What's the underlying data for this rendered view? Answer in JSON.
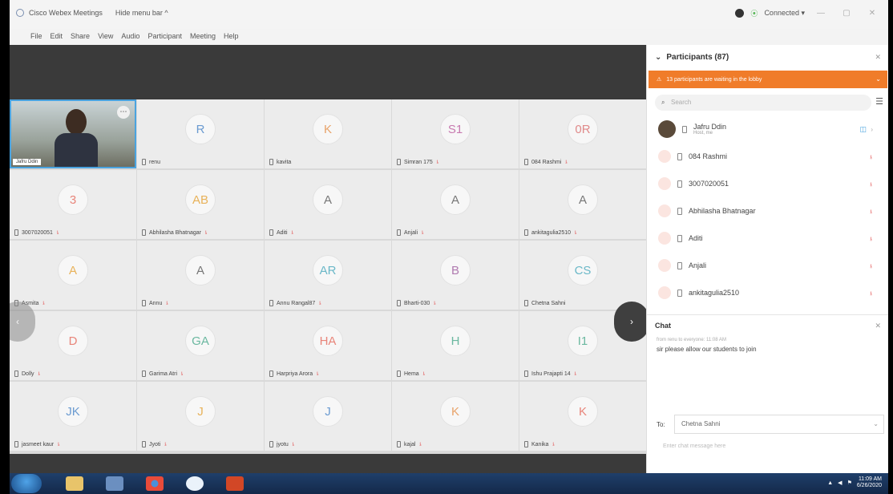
{
  "titlebar": {
    "app_name": "Cisco Webex Meetings",
    "hide_menu": "Hide menu bar ^",
    "status": "Connected ▾"
  },
  "menu": [
    "File",
    "Edit",
    "Share",
    "View",
    "Audio",
    "Participant",
    "Meeting",
    "Help"
  ],
  "host_tile": {
    "name": "Jafru Ddin"
  },
  "tiles": [
    {
      "initials": "R",
      "name": "renu",
      "color": "#6b9bd1",
      "muted": false
    },
    {
      "initials": "K",
      "name": "kavita",
      "color": "#e8a36a",
      "muted": false
    },
    {
      "initials": "S1",
      "name": "Simran 175",
      "color": "#c87ab0",
      "muted": true
    },
    {
      "initials": "0R",
      "name": "084 Rashmi",
      "color": "#e08a8a",
      "muted": true
    },
    {
      "initials": "3",
      "name": "3007020051",
      "color": "#e8857a",
      "muted": true
    },
    {
      "initials": "AB",
      "name": "Abhilasha Bhatnagar",
      "color": "#e8b25a",
      "muted": true
    },
    {
      "initials": "A",
      "name": "Aditi",
      "color": "#777777",
      "muted": true
    },
    {
      "initials": "A",
      "name": "Anjali",
      "color": "#777777",
      "muted": true
    },
    {
      "initials": "A",
      "name": "ankitagulia2510",
      "color": "#777777",
      "muted": true
    },
    {
      "initials": "A",
      "name": "Asmita",
      "color": "#e8b25a",
      "muted": true
    },
    {
      "initials": "A",
      "name": "Annu",
      "color": "#777777",
      "muted": true
    },
    {
      "initials": "AR",
      "name": "Annu Rangal87",
      "color": "#6bb8c8",
      "muted": true
    },
    {
      "initials": "B",
      "name": "Bharti-030",
      "color": "#b07ab0",
      "muted": true
    },
    {
      "initials": "CS",
      "name": "Chetna Sahni",
      "color": "#6bb8c8",
      "muted": false
    },
    {
      "initials": "D",
      "name": "Dolly",
      "color": "#e8857a",
      "muted": true
    },
    {
      "initials": "GA",
      "name": "Garima Atri",
      "color": "#6bb8a0",
      "muted": true
    },
    {
      "initials": "HA",
      "name": "Harpriya Arora",
      "color": "#e8857a",
      "muted": true
    },
    {
      "initials": "H",
      "name": "Hema",
      "color": "#6bb8a0",
      "muted": true
    },
    {
      "initials": "I1",
      "name": "Ishu Prajapti 14",
      "color": "#6bb8a0",
      "muted": true
    },
    {
      "initials": "JK",
      "name": "jasmeet kaur",
      "color": "#6b9bd1",
      "muted": true
    },
    {
      "initials": "J",
      "name": "Jyoti",
      "color": "#e8b25a",
      "muted": true
    },
    {
      "initials": "J",
      "name": "jyotu",
      "color": "#6b9bd1",
      "muted": true
    },
    {
      "initials": "K",
      "name": "kajal",
      "color": "#e8a36a",
      "muted": true
    },
    {
      "initials": "K",
      "name": "Kanika",
      "color": "#e8857a",
      "muted": true
    }
  ],
  "panel": {
    "title": "Participants (87)",
    "lobby_text": "13 participants are waiting in the lobby",
    "search_placeholder": "Search",
    "host": {
      "name": "Jafru Ddin",
      "role": "Host, me"
    },
    "list": [
      "084 Rashmi",
      "3007020051",
      "Abhilasha Bhatnagar",
      "Aditi",
      "Anjali",
      "ankitagulia2510"
    ]
  },
  "chat": {
    "title": "Chat",
    "meta": "from renu to everyone: 11:08 AM",
    "message": "sir please allow our students to join",
    "to_label": "To:",
    "to_value": "Chetna Sahni",
    "input_placeholder": "Enter chat message here"
  },
  "taskbar": {
    "time": "11:09 AM",
    "date": "6/26/2020"
  }
}
